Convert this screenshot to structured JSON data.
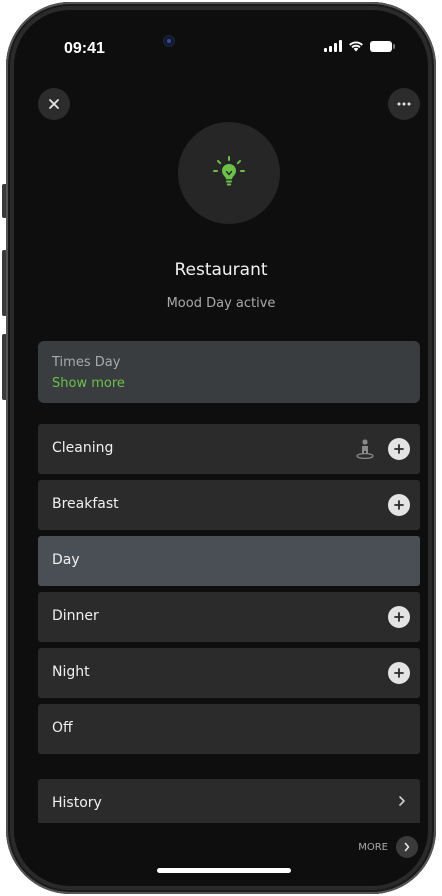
{
  "status_bar": {
    "time": "09:41"
  },
  "header": {
    "close_icon": "close-icon",
    "more_icon": "more-horizontal-icon"
  },
  "room": {
    "icon": "lightbulb-icon",
    "icon_color": "#6cc04a",
    "title": "Restaurant",
    "subtitle": "Mood Day active"
  },
  "times_card": {
    "label": "Times Day",
    "link": "Show more"
  },
  "moods": [
    {
      "label": "Cleaning",
      "has_plus": true,
      "has_cleaning_icon": true,
      "active": false
    },
    {
      "label": "Breakfast",
      "has_plus": true,
      "active": false
    },
    {
      "label": "Day",
      "has_plus": false,
      "active": true
    },
    {
      "label": "Dinner",
      "has_plus": true,
      "active": false
    },
    {
      "label": "Night",
      "has_plus": true,
      "active": false
    },
    {
      "label": "Off",
      "has_plus": false,
      "active": false
    }
  ],
  "history": {
    "label": "History",
    "chevron": ">"
  },
  "footer": {
    "more_label": "MORE"
  },
  "colors": {
    "background": "#0e0e0e",
    "row": "#2b2b2b",
    "row_active": "#4a4f55",
    "accent": "#6cc04a"
  }
}
